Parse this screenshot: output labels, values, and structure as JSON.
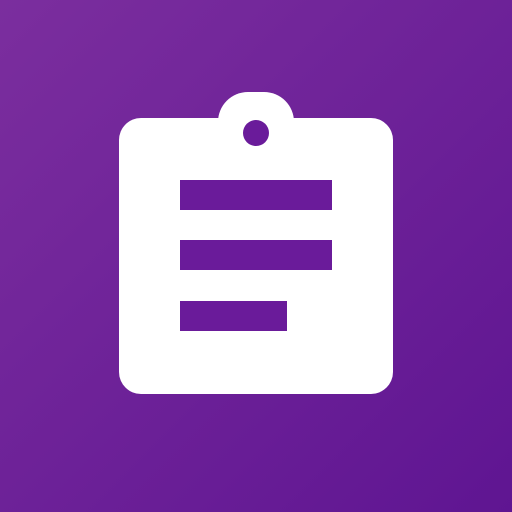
{
  "icon": {
    "name": "clipboard-icon",
    "colors": {
      "background_start": "#7b2e9e",
      "background_end": "#5f1592",
      "clipboard": "#ffffff",
      "lines": "#6a1b9a"
    }
  }
}
